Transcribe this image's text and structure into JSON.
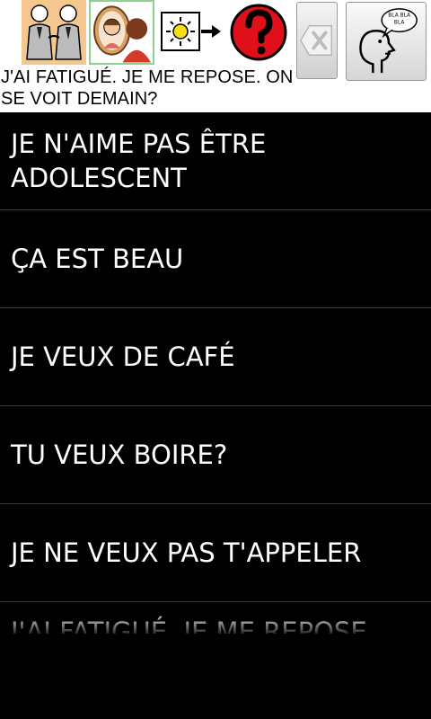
{
  "message": {
    "text": "J'AI FATIGUÉ. JE ME REPOSE. ON SE VOIT DEMAIN?"
  },
  "toolbar": {
    "symbols": [
      {
        "icon": "two-people-icon"
      },
      {
        "icon": "mirror-girl-icon"
      },
      {
        "icon": "light-arrow-icon"
      },
      {
        "icon": "question-mark-icon"
      }
    ],
    "delete_icon": "backspace-icon",
    "speak_icon": "speaking-head-icon",
    "speech_bubble_text": "BLA BLA BLA"
  },
  "phrases": [
    "JE N'AIME PAS ÊTRE ADOLESCENT",
    "ÇA EST BEAU",
    "JE VEUX DE CAFÉ",
    "TU VEUX BOIRE?",
    "JE NE VEUX PAS T'APPELER",
    "J'AI FATIGUÉ. JE ME REPOSE. ON SE VOIT DEMAIN?"
  ],
  "colors": {
    "background": "#000000",
    "panel": "#ffffff",
    "question_red": "#e10f1a",
    "row_divider": "#3a3a3a"
  }
}
